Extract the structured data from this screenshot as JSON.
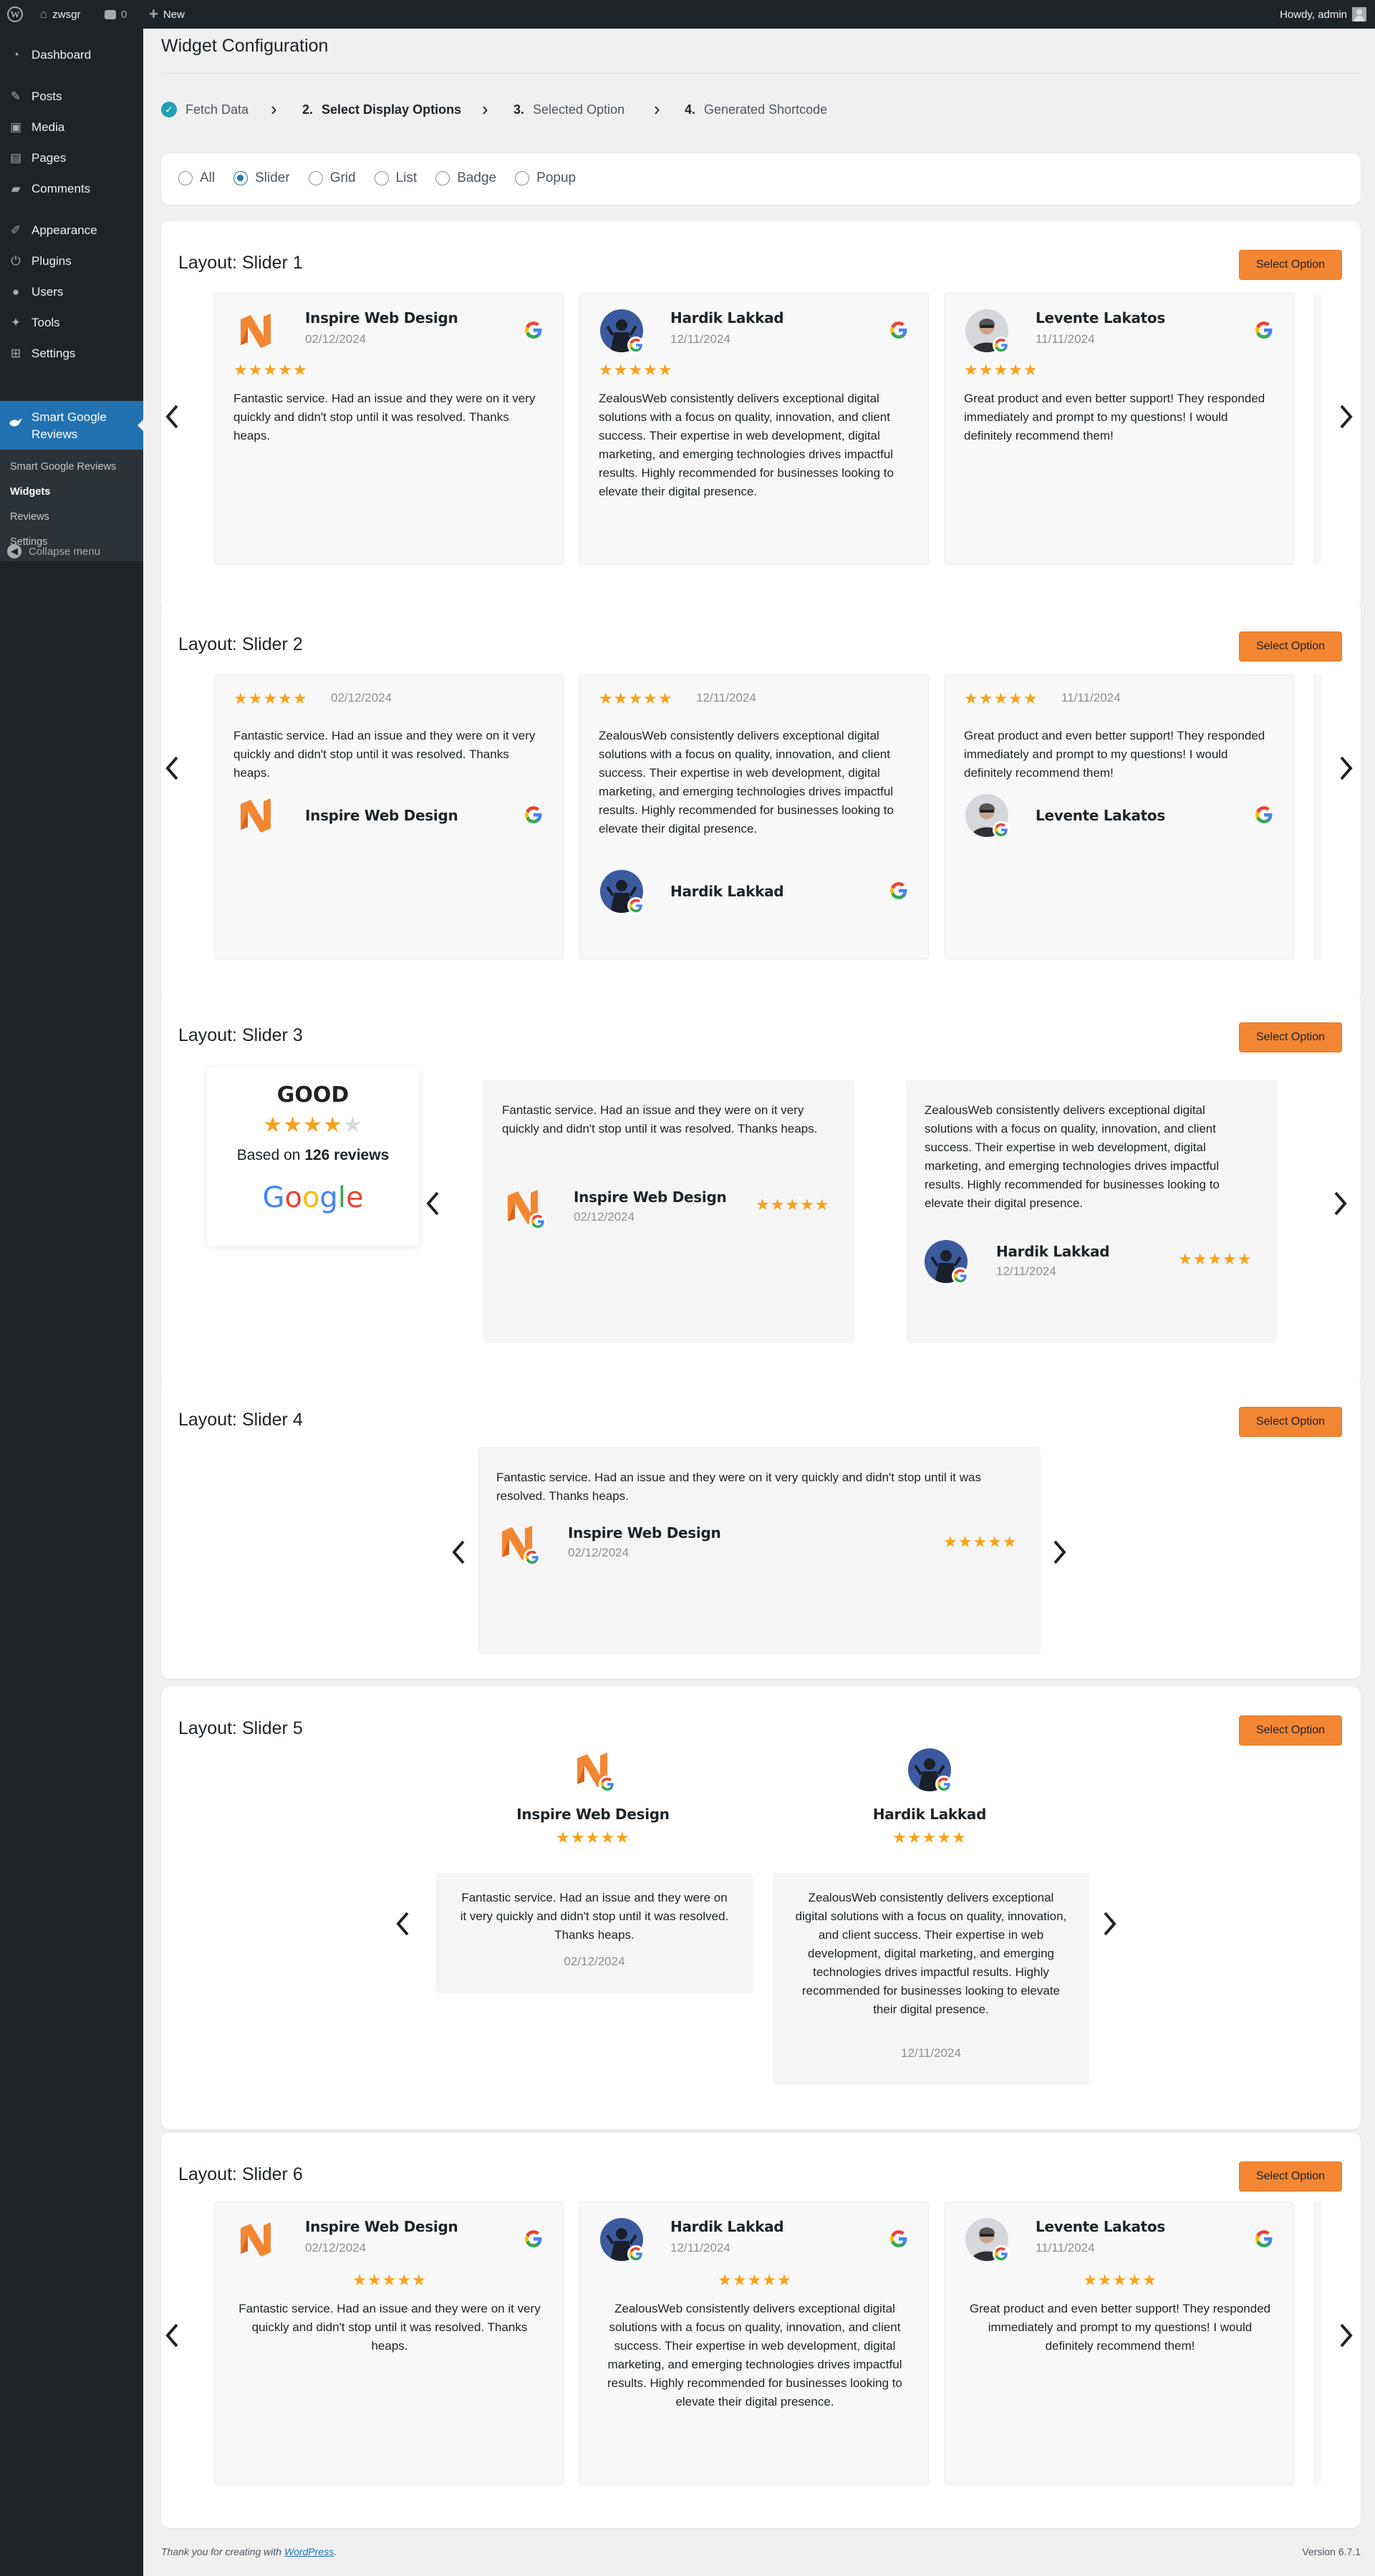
{
  "admin_bar": {
    "site": "zwsgr",
    "comments": "0",
    "new": "New",
    "howdy": "Howdy, admin"
  },
  "menu": [
    {
      "label": "Dashboard",
      "icon": "dashboard-icon"
    },
    {
      "label": "Posts",
      "icon": "pin-icon"
    },
    {
      "label": "Media",
      "icon": "media-icon"
    },
    {
      "label": "Pages",
      "icon": "pages-icon"
    },
    {
      "label": "Comments",
      "icon": "comment-icon"
    },
    {
      "label": "Appearance",
      "icon": "brush-icon"
    },
    {
      "label": "Plugins",
      "icon": "plug-icon"
    },
    {
      "label": "Users",
      "icon": "user-icon"
    },
    {
      "label": "Tools",
      "icon": "wrench-icon"
    },
    {
      "label": "Settings",
      "icon": "settings-icon"
    }
  ],
  "active_menu": {
    "line1": "Smart Google",
    "line2": "Reviews"
  },
  "submenu": [
    "Smart Google Reviews",
    "Widgets",
    "Reviews",
    "Settings"
  ],
  "collapse": "Collapse menu",
  "page_title": "Widget Configuration",
  "steps": {
    "s1": "Fetch Data",
    "s2n": "2.",
    "s2": "Select Display Options",
    "s3n": "3.",
    "s3": "Selected Option",
    "s4n": "4.",
    "s4": "Generated Shortcode"
  },
  "filters": [
    "All",
    "Slider",
    "Grid",
    "List",
    "Badge",
    "Popup"
  ],
  "selected_filter": "Slider",
  "select_label": "Select Option",
  "layouts": [
    "Layout: Slider 1",
    "Layout: Slider 2",
    "Layout: Slider 3",
    "Layout: Slider 4",
    "Layout: Slider 5",
    "Layout: Slider 6"
  ],
  "reviews": [
    {
      "name": "Inspire Web Design",
      "date": "02/12/2024",
      "rating": 5,
      "text": "Fantastic service. Had an issue and they were on it very quickly and didn't stop until it was resolved. Thanks heaps."
    },
    {
      "name": "Hardik Lakkad",
      "date": "12/11/2024",
      "rating": 5,
      "text": "ZealousWeb consistently delivers exceptional digital solutions with a focus on quality, innovation, and client success. Their expertise in web development, digital marketing, and emerging technologies drives impactful results. Highly recommended for businesses looking to elevate their digital presence."
    },
    {
      "name": "Levente Lakatos",
      "date": "11/11/2024",
      "rating": 5,
      "text": "Great product and even better support! They responded immediately and prompt to my questions! I would definitely recommend them!"
    }
  ],
  "badge": {
    "rating_word": "GOOD",
    "based_prefix": "Based on ",
    "count": "126 reviews",
    "brand": "Google",
    "rating": 4.5
  },
  "footer": {
    "thanks": "Thank you for creating with ",
    "link": "WordPress",
    "dot": ".",
    "version": "Version 6.7.1"
  },
  "colors": {
    "accent": "#f38633",
    "wp_blue": "#2271b1",
    "star": "#f7a21b",
    "sidebar": "#1d2327"
  }
}
